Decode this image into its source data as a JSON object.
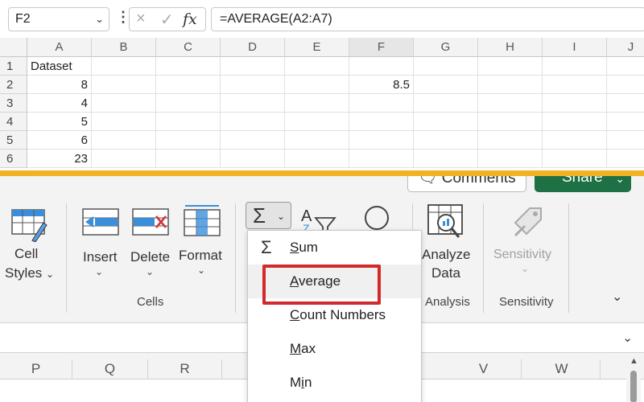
{
  "formula_bar": {
    "name_box": "F2",
    "formula": "=AVERAGE(A2:A7)",
    "cancel_icon": "×",
    "confirm_icon": "✓",
    "fx_icon": "fx"
  },
  "grid": {
    "columns": [
      "A",
      "B",
      "C",
      "D",
      "E",
      "F",
      "G",
      "H",
      "I",
      "J"
    ],
    "rows": [
      "1",
      "2",
      "3",
      "4",
      "5",
      "6"
    ],
    "cells": {
      "A1": "Dataset",
      "A2": "8",
      "A3": "4",
      "A4": "5",
      "A5": "6",
      "A6": "23",
      "F2": "8.5"
    }
  },
  "ribbon": {
    "comments_label": "Comments",
    "share_label": "Share",
    "cell_styles": [
      "Cell",
      "Styles"
    ],
    "insert_label": "Insert",
    "delete_label": "Delete",
    "format_label": "Format",
    "cells_group": "Cells",
    "analyze_label": [
      "Analyze",
      "Data"
    ],
    "analysis_group": "Analysis",
    "sensitivity_label": "Sensitivity",
    "sensitivity_group": "Sensitivity",
    "sigma_icon": "Σ",
    "caret_icon": "⌄"
  },
  "autosum_menu": {
    "items": [
      {
        "label": "Sum",
        "accel": "S",
        "rest": "um"
      },
      {
        "label": "Average",
        "accel": "A",
        "rest": "verage"
      },
      {
        "label": "Count Numbers",
        "accel": "C",
        "rest": "ount Numbers"
      },
      {
        "label": "Max",
        "accel": "M",
        "rest": "ax"
      },
      {
        "label": "Min",
        "pre": "M",
        "accel": "i",
        "rest": "n"
      }
    ]
  },
  "lower_grid": {
    "columns": [
      "P",
      "Q",
      "R",
      "V",
      "W"
    ]
  },
  "colors": {
    "divider": "#f0b323",
    "share_green": "#1e7145",
    "highlight_red": "#d22a2a"
  }
}
